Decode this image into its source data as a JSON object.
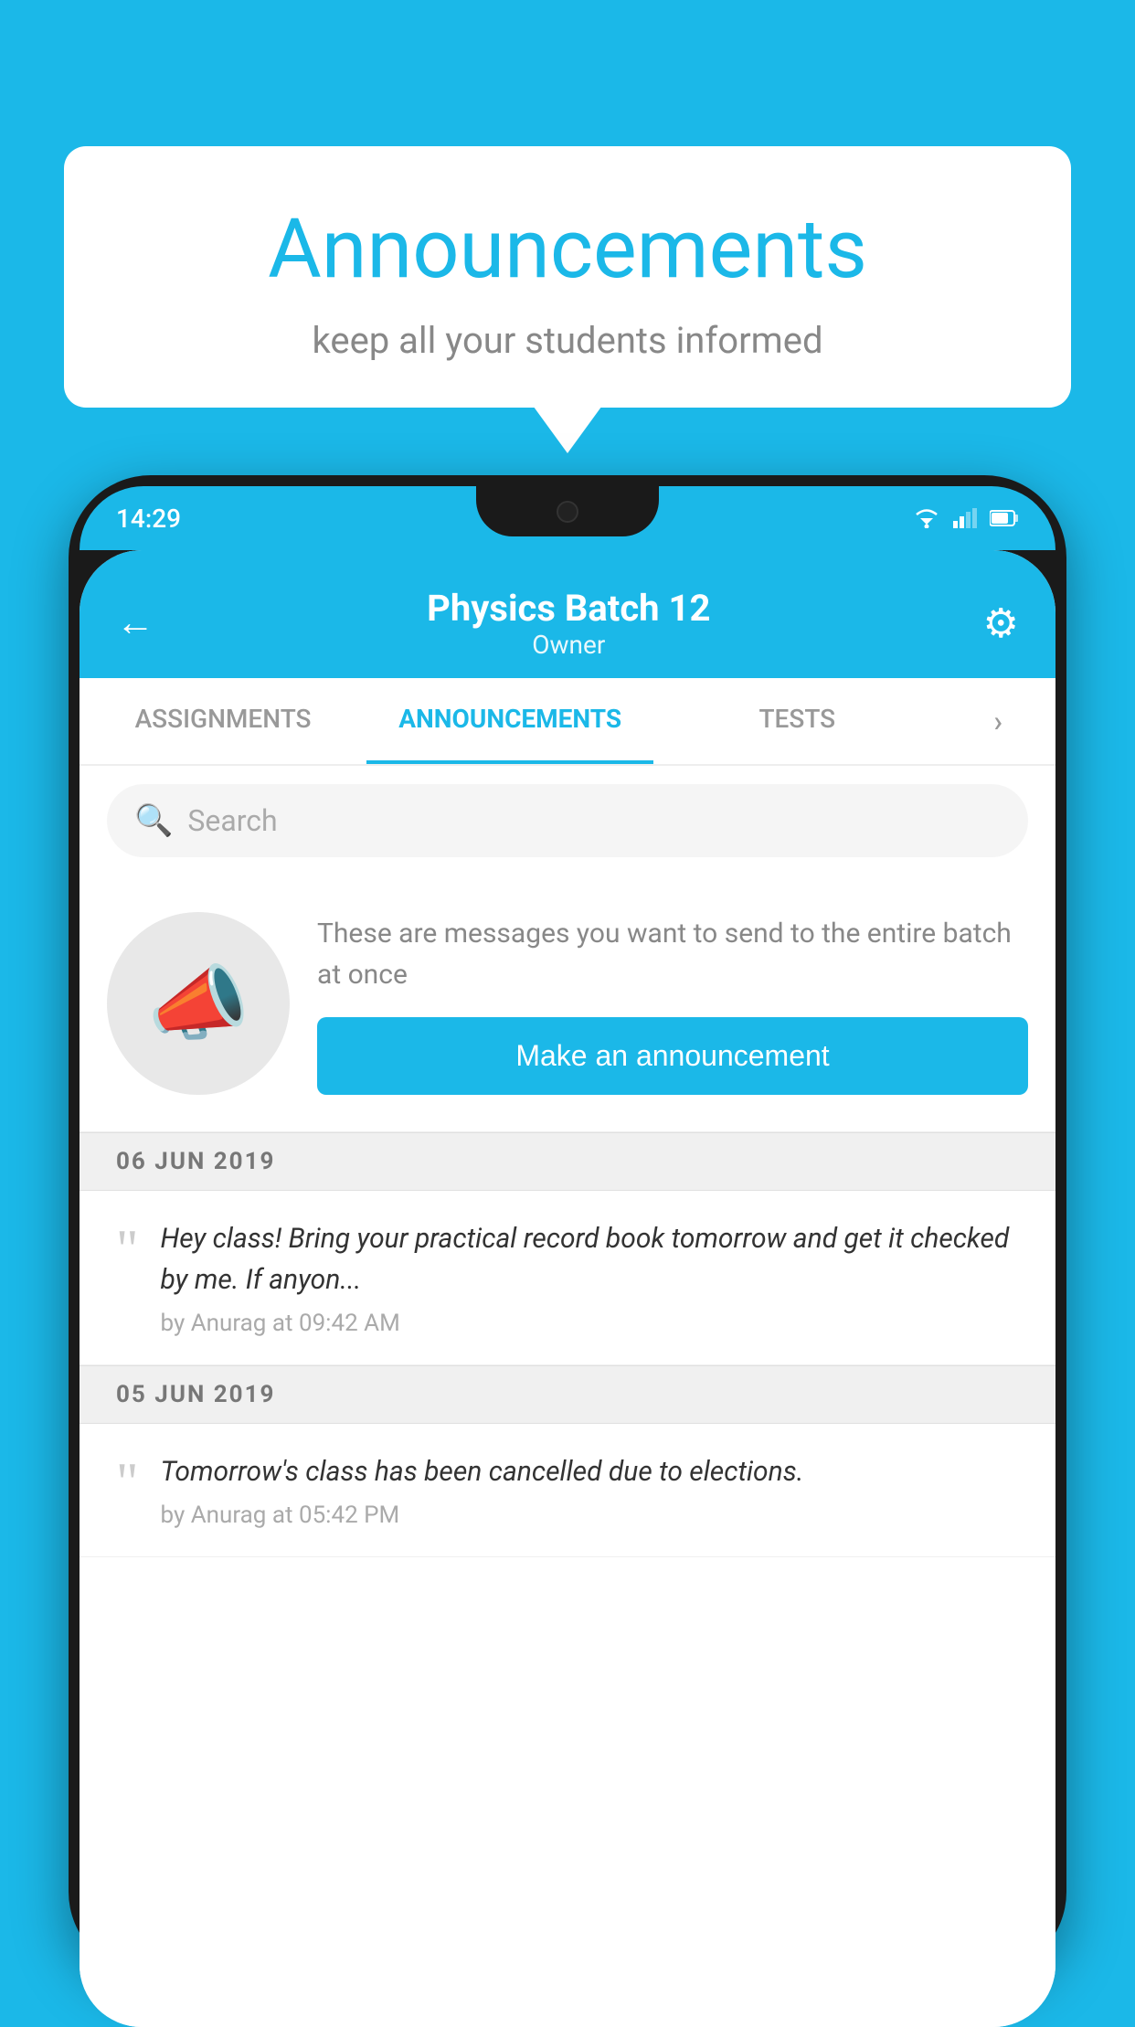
{
  "background_color": "#1BB8E8",
  "speech_bubble": {
    "title": "Announcements",
    "subtitle": "keep all your students informed"
  },
  "status_bar": {
    "time": "14:29"
  },
  "app_header": {
    "title": "Physics Batch 12",
    "subtitle": "Owner",
    "back_label": "←",
    "gear_label": "⚙"
  },
  "tabs": [
    {
      "label": "ASSIGNMENTS",
      "active": false
    },
    {
      "label": "ANNOUNCEMENTS",
      "active": true
    },
    {
      "label": "TESTS",
      "active": false
    },
    {
      "label": "›",
      "active": false
    }
  ],
  "search": {
    "placeholder": "Search"
  },
  "announcement_prompt": {
    "description": "These are messages you want to send to the entire batch at once",
    "button_label": "Make an announcement"
  },
  "announcements": [
    {
      "date": "06  JUN  2019",
      "text": "Hey class! Bring your practical record book tomorrow and get it checked by me. If anyon...",
      "meta": "by Anurag at 09:42 AM"
    },
    {
      "date": "05  JUN  2019",
      "text": "Tomorrow's class has been cancelled due to elections.",
      "meta": "by Anurag at 05:42 PM"
    }
  ],
  "icons": {
    "back": "←",
    "gear": "⚙",
    "search": "🔍",
    "quote": "““",
    "megaphone": "📣"
  }
}
